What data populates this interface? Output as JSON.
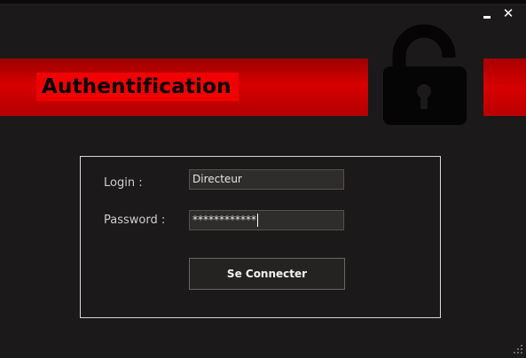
{
  "window": {
    "minimize_icon": "minimize-icon",
    "close_label": "✕",
    "close_icon": "close-icon"
  },
  "banner": {
    "title": "Authentification",
    "title_bg": "#f00000",
    "band_color": "#d70000",
    "lock_icon": "unlocked-padlock-icon"
  },
  "form": {
    "login_label": "Login :",
    "login_value": "Directeur",
    "password_label": "Password :",
    "password_value": "************",
    "submit_label": "Se Connecter"
  },
  "colors": {
    "background": "#1b1919",
    "panel_border": "#d8d8d8",
    "accent": "#d70000"
  }
}
